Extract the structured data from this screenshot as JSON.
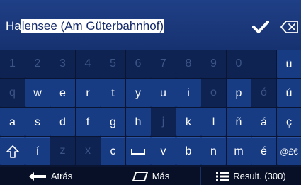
{
  "input": {
    "typed": "Ha",
    "suggestion": "lensee (Am Güterbahnhof)"
  },
  "icons": {
    "confirm": "check-icon",
    "delete": "backspace-icon",
    "shift": "shift-arrow-icon",
    "space": "space-icon",
    "back": "arrow-left-icon",
    "more": "keyboard-toggle-icon",
    "results": "list-icon"
  },
  "keyboard": {
    "rows": [
      [
        {
          "label": "1",
          "enabled": false
        },
        {
          "label": "2",
          "enabled": false
        },
        {
          "label": "3",
          "enabled": false
        },
        {
          "label": "4",
          "enabled": false
        },
        {
          "label": "5",
          "enabled": false
        },
        {
          "label": "6",
          "enabled": false
        },
        {
          "label": "7",
          "enabled": false
        },
        {
          "label": "8",
          "enabled": false
        },
        {
          "label": "9",
          "enabled": false
        },
        {
          "label": "0",
          "enabled": false
        },
        {
          "label": "",
          "enabled": false
        },
        {
          "label": "ü",
          "enabled": true
        }
      ],
      [
        {
          "label": "q",
          "enabled": false
        },
        {
          "label": "w",
          "enabled": true
        },
        {
          "label": "e",
          "enabled": true
        },
        {
          "label": "r",
          "enabled": true
        },
        {
          "label": "t",
          "enabled": true
        },
        {
          "label": "y",
          "enabled": true
        },
        {
          "label": "u",
          "enabled": true
        },
        {
          "label": "i",
          "enabled": true
        },
        {
          "label": "o",
          "enabled": false
        },
        {
          "label": "p",
          "enabled": true
        },
        {
          "label": "ó",
          "enabled": false
        },
        {
          "label": "ú",
          "enabled": true
        }
      ],
      [
        {
          "label": "a",
          "enabled": true
        },
        {
          "label": "s",
          "enabled": true
        },
        {
          "label": "d",
          "enabled": true
        },
        {
          "label": "f",
          "enabled": true
        },
        {
          "label": "g",
          "enabled": true
        },
        {
          "label": "h",
          "enabled": true
        },
        {
          "label": "j",
          "enabled": false
        },
        {
          "label": "k",
          "enabled": true
        },
        {
          "label": "l",
          "enabled": true
        },
        {
          "label": "ñ",
          "enabled": true
        },
        {
          "label": "á",
          "enabled": true
        },
        {
          "label": "ç",
          "enabled": true
        }
      ],
      [
        {
          "label": "",
          "enabled": true,
          "icon": "shift"
        },
        {
          "label": "í",
          "enabled": true
        },
        {
          "label": "z",
          "enabled": false
        },
        {
          "label": "x",
          "enabled": false
        },
        {
          "label": "c",
          "enabled": true
        },
        {
          "label": "",
          "enabled": true,
          "icon": "space"
        },
        {
          "label": "v",
          "enabled": true
        },
        {
          "label": "b",
          "enabled": true
        },
        {
          "label": "n",
          "enabled": true
        },
        {
          "label": "m",
          "enabled": true
        },
        {
          "label": "é",
          "enabled": true
        },
        {
          "label": "@£€",
          "enabled": true
        }
      ]
    ]
  },
  "bottom": {
    "back_label": "Atrás",
    "more_label": "Más",
    "results_label": "Result. (300)"
  },
  "colors": {
    "key_enabled": "#173c84",
    "key_disabled": "#0f2352",
    "text": "#ffffff"
  }
}
